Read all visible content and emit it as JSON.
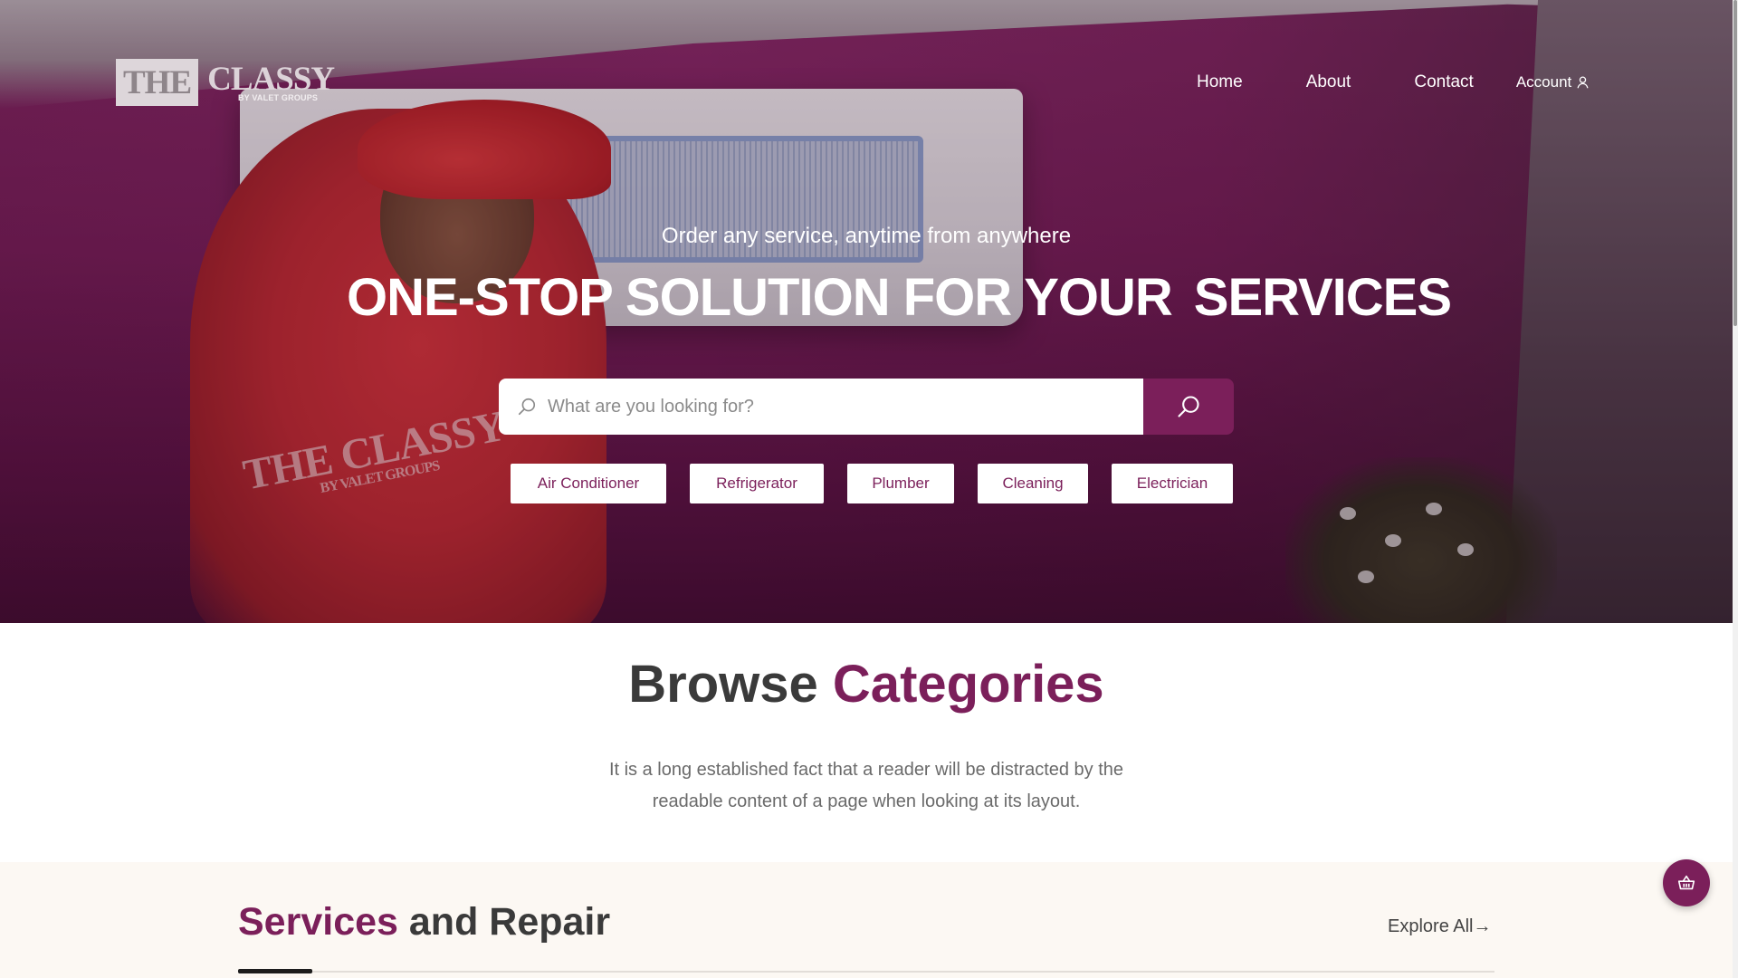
{
  "brand": {
    "logo_box": "THE",
    "logo_word": "CLASSY",
    "logo_sub": "BY VALET GROUPS"
  },
  "nav": {
    "home": "Home",
    "about": "About",
    "contact": "Contact",
    "account": "Account",
    "account_icon": "user-icon"
  },
  "hero": {
    "tagline": "Order any service, anytime from anywhere",
    "headline_main": "ONE-STOP SOLUTION FOR YOUR",
    "headline_highlight": "SERVICES",
    "search": {
      "placeholder": "What are you looking for?",
      "value": "",
      "field_icon": "search-icon",
      "button_icon": "search-icon"
    },
    "chips": [
      "Air Conditioner",
      "Refrigerator",
      "Plumber",
      "Cleaning",
      "Electrician"
    ],
    "shirt_logo": "THE CLASSY",
    "shirt_logo_sub": "BY VALET GROUPS"
  },
  "browse": {
    "title_plain": "Browse",
    "title_accent": "Categories",
    "description": "It is a long established fact that a reader will be distracted by the readable content of a page when looking at its layout."
  },
  "services_section": {
    "title_accent": "Services",
    "title_plain": "and Repair",
    "explore_label": "Explore All→"
  },
  "fab": {
    "icon": "basket-icon"
  },
  "colors": {
    "accent": "#7b1f5a",
    "section_bg": "#fcf8f3",
    "text_dark": "#3a3a3a",
    "text_muted": "#6a6a6a"
  }
}
